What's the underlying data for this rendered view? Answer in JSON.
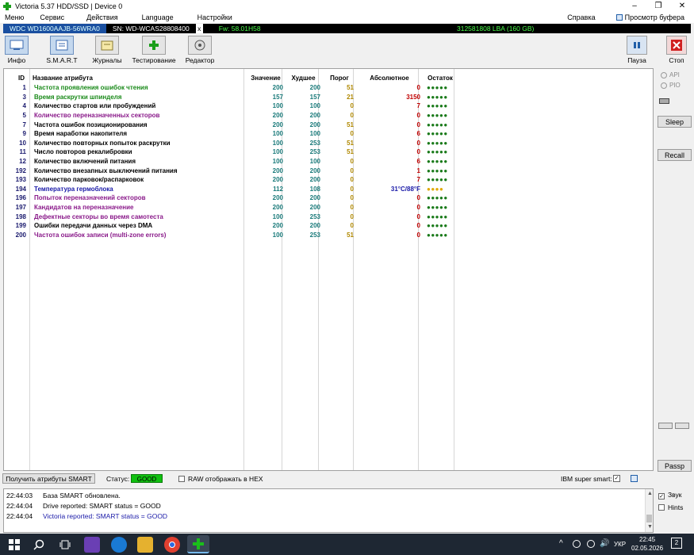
{
  "window": {
    "title": "Victoria 5.37 HDD/SSD | Device 0",
    "min": "–",
    "max": "❐",
    "close": "✕"
  },
  "menu": {
    "items": [
      "Меню",
      "Сервис",
      "Действия",
      "Language",
      "Настройки"
    ],
    "help": "Справка",
    "buffer_view": "Просмотр буфера"
  },
  "device": {
    "model": "WDC WD1600AAJB-56WRA0",
    "serial": "SN: WD-WCAS28808400",
    "close": "x",
    "firmware": "Fw: 58.01H58",
    "capacity": "312581808 LBA (160 GB)"
  },
  "toolbar": {
    "buttons": [
      {
        "label": "Инфо",
        "icon": "info-icon"
      },
      {
        "label": "S.M.A.R.T",
        "icon": "smart-icon"
      },
      {
        "label": "Журналы",
        "icon": "journal-icon"
      },
      {
        "label": "Тестирование",
        "icon": "test-icon"
      },
      {
        "label": "Редактор",
        "icon": "editor-icon"
      }
    ],
    "pause": "Пауза",
    "stop": "Стоп"
  },
  "smart_table": {
    "columns": [
      "ID",
      "Название атрибута",
      "Значение",
      "Худшее",
      "Порог",
      "Абсолютное",
      "Остаток"
    ],
    "rows": [
      {
        "id": "1",
        "name": "Частота проявления ошибок чтения",
        "value": "200",
        "worst": "200",
        "threshold": "51",
        "raw": "0",
        "remain": "●●●●●",
        "color": "#1a8a1a"
      },
      {
        "id": "3",
        "name": "Время раскрутки шпинделя",
        "value": "157",
        "worst": "157",
        "threshold": "21",
        "raw": "3150",
        "remain": "●●●●●",
        "color": "#1a8a1a"
      },
      {
        "id": "4",
        "name": "Количество стартов или пробуждений",
        "value": "100",
        "worst": "100",
        "threshold": "0",
        "raw": "7",
        "remain": "●●●●●",
        "color": "#000000"
      },
      {
        "id": "5",
        "name": "Количество переназначенных секторов",
        "value": "200",
        "worst": "200",
        "threshold": "0",
        "raw": "0",
        "remain": "●●●●●",
        "color": "#8a1a8a"
      },
      {
        "id": "7",
        "name": "Частота ошибок позиционирования",
        "value": "200",
        "worst": "200",
        "threshold": "51",
        "raw": "0",
        "remain": "●●●●●",
        "color": "#000000"
      },
      {
        "id": "9",
        "name": "Время наработки накопителя",
        "value": "100",
        "worst": "100",
        "threshold": "0",
        "raw": "6",
        "remain": "●●●●●",
        "color": "#000000"
      },
      {
        "id": "10",
        "name": "Количество повторных попыток раскрутки",
        "value": "100",
        "worst": "253",
        "threshold": "51",
        "raw": "0",
        "remain": "●●●●●",
        "color": "#000000"
      },
      {
        "id": "11",
        "name": "Число повторов рекалибровки",
        "value": "100",
        "worst": "253",
        "threshold": "51",
        "raw": "0",
        "remain": "●●●●●",
        "color": "#000000"
      },
      {
        "id": "12",
        "name": "Количество включений питания",
        "value": "100",
        "worst": "100",
        "threshold": "0",
        "raw": "6",
        "remain": "●●●●●",
        "color": "#000000"
      },
      {
        "id": "192",
        "name": "Количество внезапных выключений питания",
        "value": "200",
        "worst": "200",
        "threshold": "0",
        "raw": "1",
        "remain": "●●●●●",
        "color": "#000000"
      },
      {
        "id": "193",
        "name": "Количество парковок/распарковок",
        "value": "200",
        "worst": "200",
        "threshold": "0",
        "raw": "7",
        "remain": "●●●●●",
        "color": "#000000"
      },
      {
        "id": "194",
        "name": "Температура гермоблока",
        "value": "112",
        "worst": "108",
        "threshold": "0",
        "raw": "31°C/88°F",
        "remain": "●●●●",
        "color": "#1a1aa8",
        "raw_color": "#1a1aa8",
        "remain_color": "#e0a800"
      },
      {
        "id": "196",
        "name": "Попыток переназначений секторов",
        "value": "200",
        "worst": "200",
        "threshold": "0",
        "raw": "0",
        "remain": "●●●●●",
        "color": "#8a1a8a"
      },
      {
        "id": "197",
        "name": "Кандидатов на переназначение",
        "value": "200",
        "worst": "200",
        "threshold": "0",
        "raw": "0",
        "remain": "●●●●●",
        "color": "#8a1a8a"
      },
      {
        "id": "198",
        "name": "Дефектные секторы во время самотеста",
        "value": "100",
        "worst": "253",
        "threshold": "0",
        "raw": "0",
        "remain": "●●●●●",
        "color": "#8a1a8a"
      },
      {
        "id": "199",
        "name": "Ошибки передачи данных через DMA",
        "value": "200",
        "worst": "200",
        "threshold": "0",
        "raw": "0",
        "remain": "●●●●●",
        "color": "#000000"
      },
      {
        "id": "200",
        "name": "Частота ошибок записи (multi-zone errors)",
        "value": "100",
        "worst": "253",
        "threshold": "51",
        "raw": "0",
        "remain": "●●●●●",
        "color": "#8a1a8a"
      }
    ]
  },
  "right_panel": {
    "api": "API",
    "pio": "PIO",
    "sleep": "Sleep",
    "recall": "Recall",
    "passp": "Passp"
  },
  "status": {
    "get_smart": "Получить атрибуты SMART",
    "status_label": "Статус:",
    "status_value": "GOOD",
    "raw_hex": "RAW отображать в HEX",
    "ibm": "IBM super smart:",
    "ibm_check": "✓"
  },
  "log": [
    {
      "time": "22:44:03",
      "msg": "База SMART обновлена.",
      "color": "#000000"
    },
    {
      "time": "22:44:04",
      "msg": "Drive reported: SMART status = GOOD",
      "color": "#000000"
    },
    {
      "time": "22:44:04",
      "msg": "Victoria reported: SMART status = GOOD",
      "color": "#1a1aa8"
    }
  ],
  "log_options": {
    "sound": "Звук",
    "hints": "Hints",
    "sound_check": "✓"
  },
  "taskbar": {
    "lang": "УКР",
    "time": "22:45",
    "date": "02.05.2026",
    "notif": "2",
    "up": "^"
  }
}
